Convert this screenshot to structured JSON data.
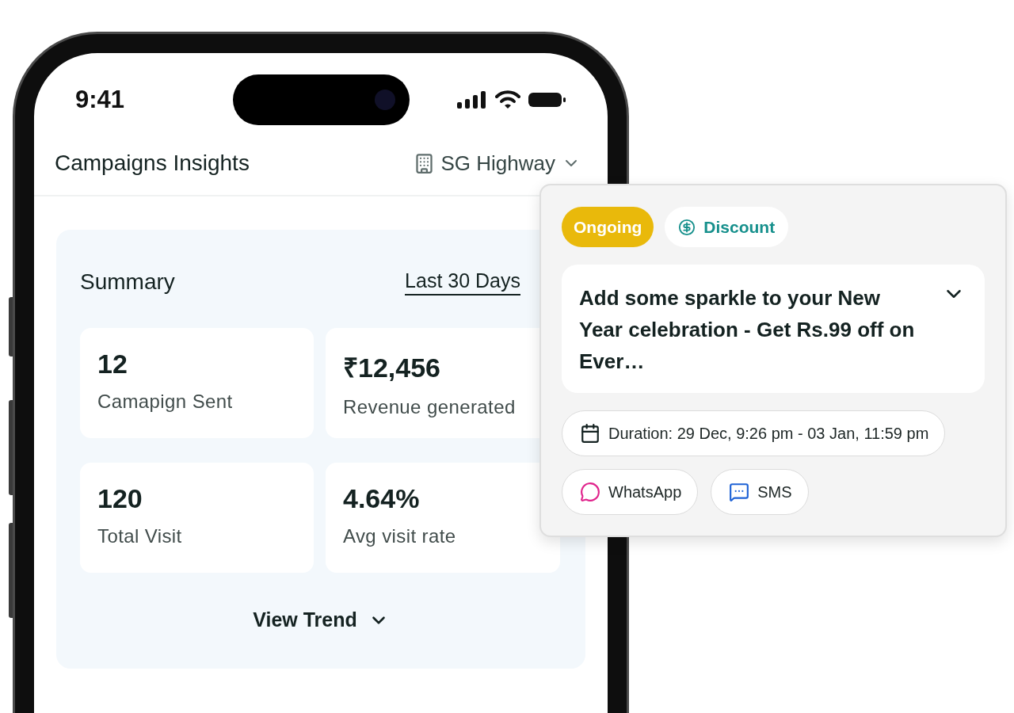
{
  "status_bar": {
    "time": "9:41"
  },
  "header": {
    "title": "Campaigns Insights",
    "location": "SG Highway"
  },
  "summary": {
    "title": "Summary",
    "period": "Last 30 Days",
    "stats": [
      {
        "value": "12",
        "label": "Camapign Sent"
      },
      {
        "value": "₹12,456",
        "label": "Revenue generated"
      },
      {
        "value": "120",
        "label": "Total Visit"
      },
      {
        "value": "4.64%",
        "label": "Avg visit rate"
      }
    ],
    "view_trend": "View Trend"
  },
  "campaign_card": {
    "status": "Ongoing",
    "type": "Discount",
    "title": "Add some sparkle to your New Year celebration - Get Rs.99 off on Ever…",
    "duration": "Duration: 29 Dec, 9:26 pm - 03 Jan, 11:59 pm",
    "channels": [
      {
        "kind": "whatsapp",
        "label": "WhatsApp"
      },
      {
        "kind": "sms",
        "label": "SMS"
      }
    ]
  }
}
